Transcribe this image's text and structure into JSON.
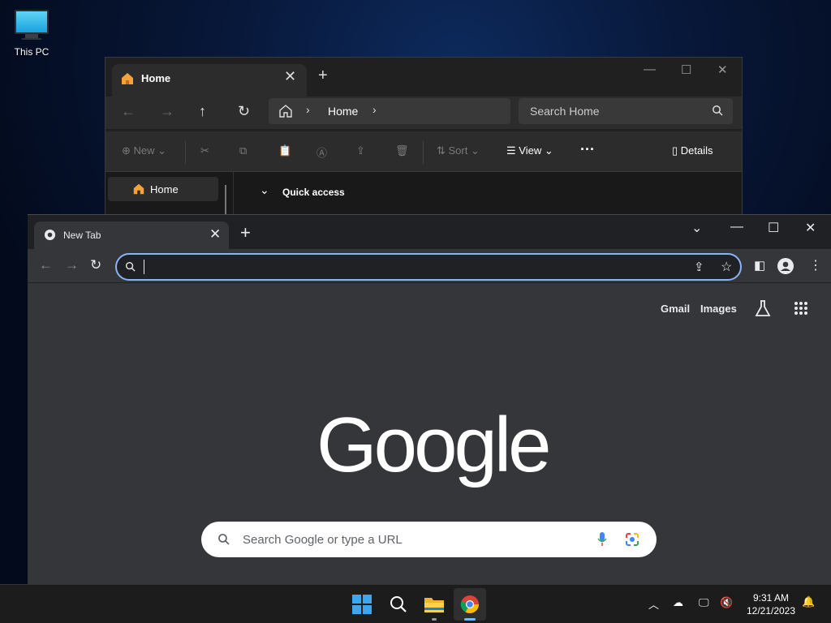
{
  "desktop": {
    "icons": [
      {
        "label": "This PC",
        "icon": "monitor-icon"
      }
    ]
  },
  "explorer": {
    "tab_title": "Home",
    "breadcrumb": "Home",
    "search_placeholder": "Search Home",
    "toolbar": {
      "new": "New",
      "sort": "Sort",
      "view": "View",
      "details": "Details"
    },
    "sidebar": [
      {
        "label": "Home"
      }
    ],
    "quick_access": "Quick access"
  },
  "chrome": {
    "tab_title": "New Tab",
    "omnibox_value": "",
    "top_links": {
      "gmail": "Gmail",
      "images": "Images"
    },
    "logo": "Google",
    "search_placeholder": "Search Google or type a URL",
    "colors": {
      "focus_ring": "#8ab4f8",
      "bg": "#35363a",
      "frame": "#202124"
    }
  },
  "taskbar": {
    "apps": [
      "start",
      "search",
      "file-explorer",
      "chrome"
    ],
    "time": "9:31 AM",
    "date": "12/21/2023"
  }
}
